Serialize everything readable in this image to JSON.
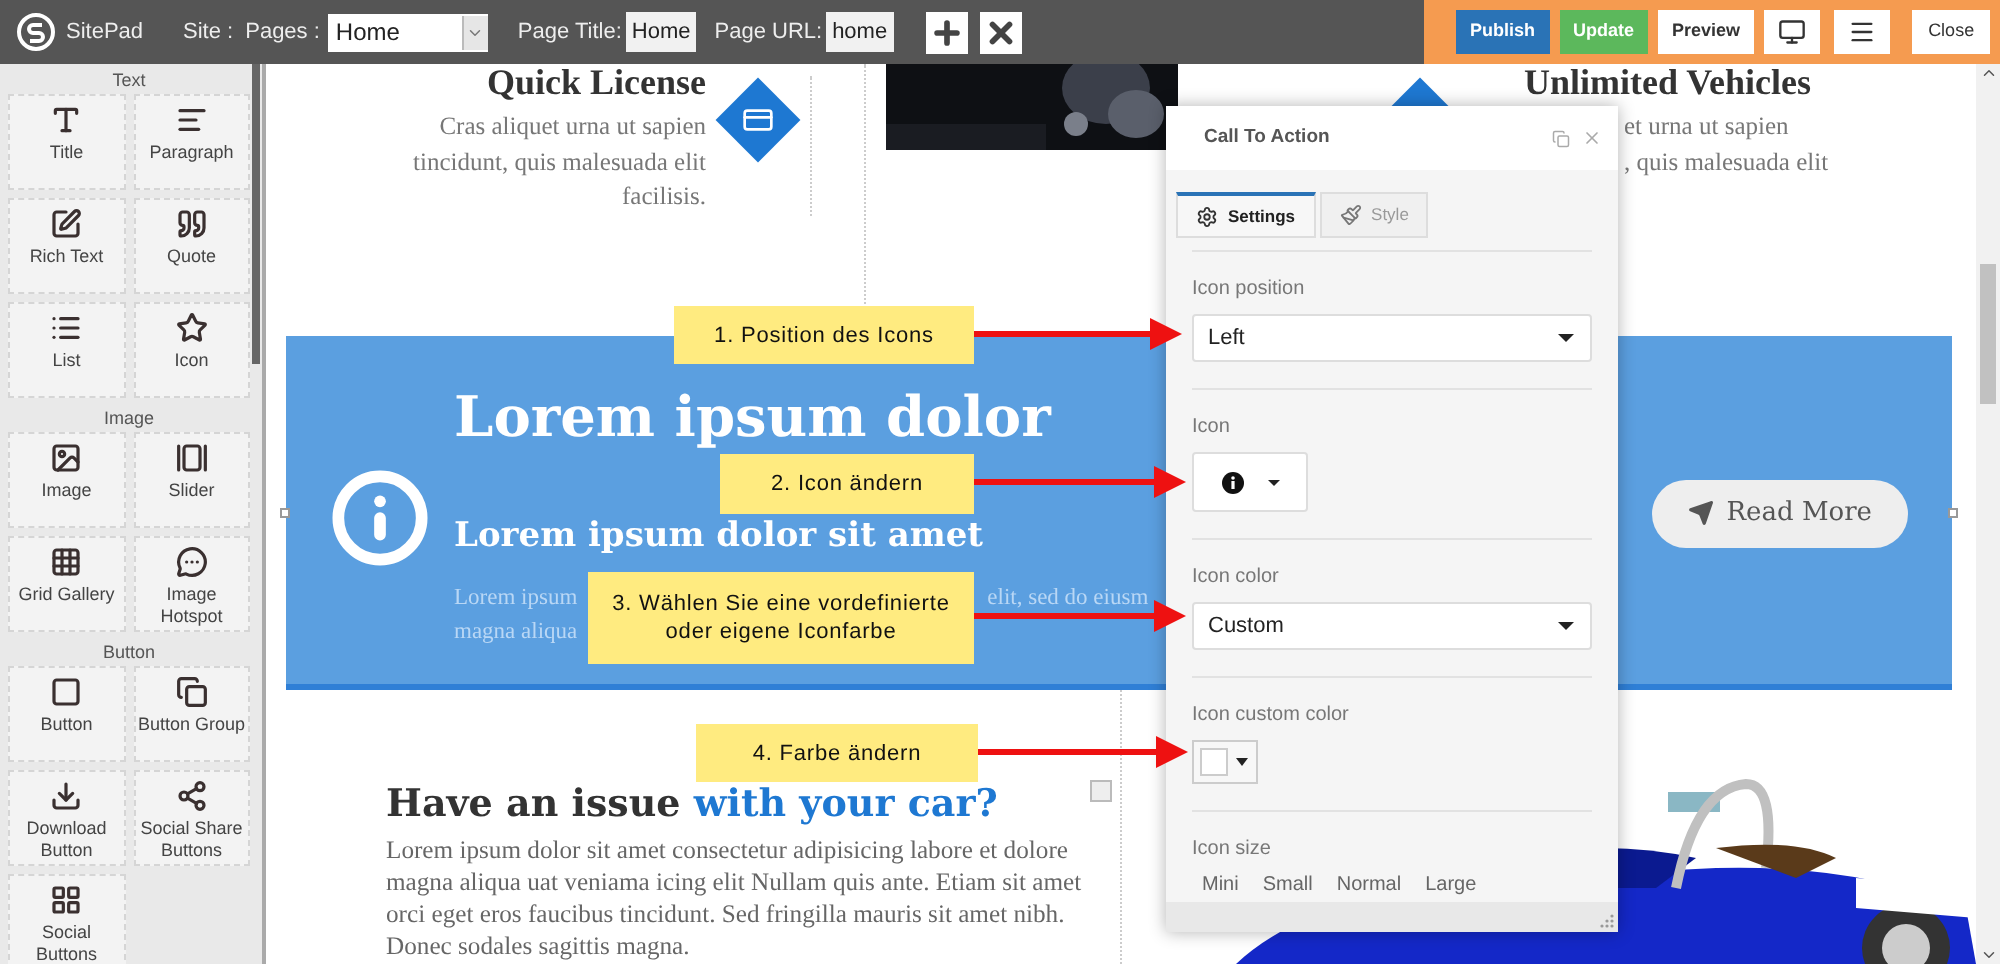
{
  "topbar": {
    "brand": "SitePad",
    "site_label": "Site :",
    "pages_label": "Pages :",
    "pages_select": "Home",
    "page_title_label": "Page Title:",
    "page_title": "Home",
    "page_url_label": "Page URL:",
    "page_url": "home",
    "actions": [
      {
        "label": "Publish",
        "kind": "primary"
      },
      {
        "label": "Update",
        "kind": "success"
      },
      {
        "label": "Preview",
        "kind": "default"
      }
    ],
    "close": "Close"
  },
  "sidebar": {
    "groups": [
      {
        "title": "Text",
        "items": [
          "Title",
          "Paragraph",
          "Rich Text",
          "Quote",
          "List",
          "Icon"
        ]
      },
      {
        "title": "Image",
        "items": [
          "Image",
          "Slider",
          "Grid Gallery",
          "Image Hotspot"
        ]
      },
      {
        "title": "Button",
        "items": [
          "Button",
          "Button Group",
          "Download Button",
          "Social Share Buttons",
          "Social Buttons"
        ]
      }
    ]
  },
  "canvas": {
    "feature_left": {
      "title": "Quick License",
      "text": "Cras aliquet urna ut sapien tincidunt, quis malesuada elit facilisis."
    },
    "feature_right": {
      "title": "Unlimited Vehicles",
      "lines": [
        "et urna ut sapien",
        ", quis malesuada elit"
      ]
    },
    "cta": {
      "heading": "Lorem ipsum dolor",
      "subheading": "Lorem ipsum dolor sit amet",
      "text_fragments": [
        "Lorem ipsum",
        "elit, sed do eiusm",
        "magna aliqua"
      ],
      "button": "Read More"
    },
    "article": {
      "title": "Have an issue",
      "title_highlight": "with your car?",
      "text": "Lorem ipsum dolor sit amet consectetur adipisicing labore et dolore magna aliqua uat veniama icing elit Nullam quis ante. Etiam sit amet orci eget eros faucibus tincidunt. Sed fringilla mauris sit amet nibh. Donec sodales sagittis magna."
    }
  },
  "panel": {
    "title": "Call To Action",
    "tabs": [
      {
        "label": "Settings",
        "selected": true
      },
      {
        "label": "Style",
        "selected": false
      }
    ],
    "fields": [
      {
        "kind": "select",
        "label": "Icon position",
        "value": "Left"
      },
      {
        "kind": "icon_picker",
        "label": "Icon"
      },
      {
        "kind": "select",
        "label": "Icon color",
        "value": "Custom"
      },
      {
        "kind": "color",
        "label": "Icon custom color"
      },
      {
        "kind": "options",
        "label": "Icon size",
        "options": [
          "Mini",
          "Small",
          "Normal",
          "Large"
        ]
      }
    ]
  },
  "callouts": [
    {
      "text": "1. Position des Icons"
    },
    {
      "text": "2. Icon ändern"
    },
    {
      "text": "3. Wählen Sie eine vordefinierte oder eigene Iconfarbe"
    },
    {
      "text": "4. Farbe ändern"
    }
  ]
}
